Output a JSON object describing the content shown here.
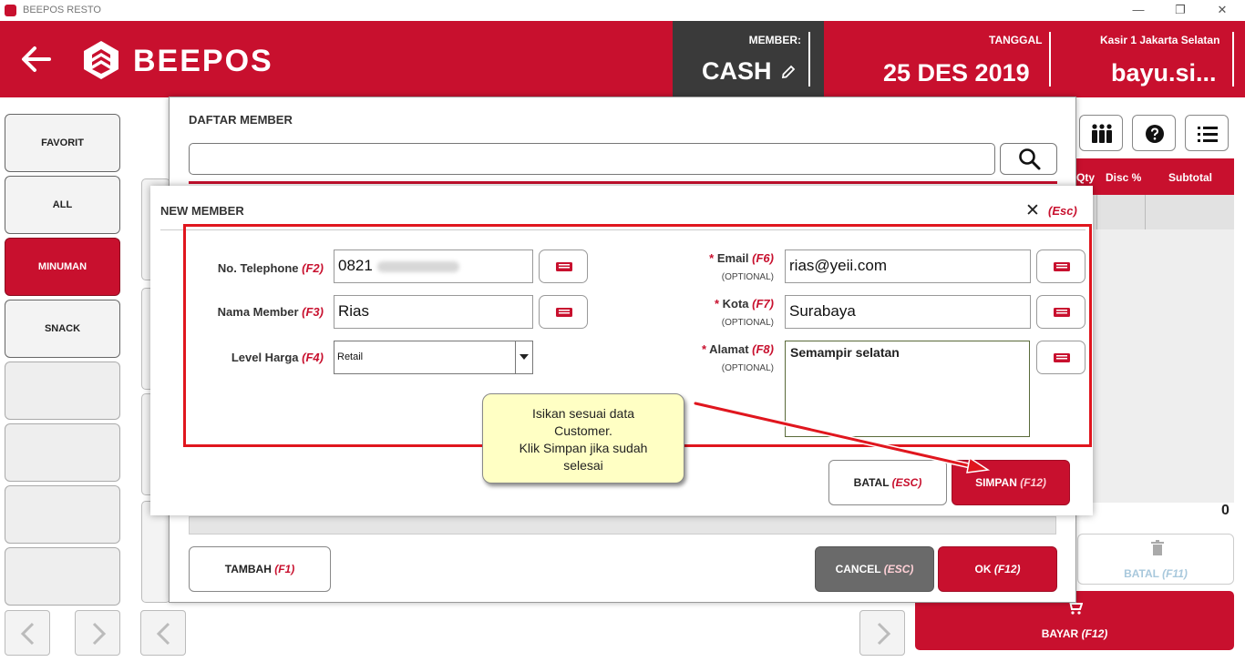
{
  "window": {
    "title": "BEEPOS RESTO",
    "controls": {
      "minimize": "—",
      "restore": "❐",
      "close": "✕"
    }
  },
  "header": {
    "brand": "BEEPOS",
    "member_label": "MEMBER:",
    "member_value": "CASH",
    "date_label": "TANGGAL",
    "date_value": "25 DES 2019",
    "cashier_label": "Kasir 1 Jakarta Selatan",
    "cashier_value": "bayu.si..."
  },
  "categories": [
    "FAVORIT",
    "ALL",
    "MINUMAN",
    "SNACK"
  ],
  "order_table": {
    "columns": [
      "Qty",
      "Disc %",
      "Subtotal"
    ],
    "total": "0"
  },
  "actions": {
    "batal_label": "BATAL",
    "batal_key": "(F11)",
    "bayar_label": "BAYAR",
    "bayar_key": "(F12)"
  },
  "daftar_member": {
    "title": "DAFTAR MEMBER",
    "search_value": "",
    "tambah_label": "TAMBAH",
    "tambah_key": "(F1)",
    "cancel_label": "CANCEL",
    "cancel_key": "(ESC)",
    "ok_label": "OK",
    "ok_key": "(F12)"
  },
  "new_member": {
    "title": "NEW MEMBER",
    "close_key": "(Esc)",
    "telephone": {
      "label": "No. Telephone",
      "key": "(F2)",
      "value": "0821"
    },
    "nama": {
      "label": "Nama Member",
      "key": "(F3)",
      "value": "Rias"
    },
    "level": {
      "label": "Level Harga",
      "key": "(F4)",
      "value": "Retail"
    },
    "email": {
      "label": "Email",
      "key": "(F6)",
      "optional": "(OPTIONAL)",
      "value": "rias@yeii.com"
    },
    "kota": {
      "label": "Kota",
      "key": "(F7)",
      "optional": "(OPTIONAL)",
      "value": "Surabaya"
    },
    "alamat": {
      "label": "Alamat",
      "key": "(F8)",
      "optional": "(OPTIONAL)",
      "value": "Semampir selatan"
    },
    "required_mark": "*",
    "batal_label": "BATAL",
    "batal_key": "(ESC)",
    "simpan_label": "SIMPAN",
    "simpan_key": "(F12)"
  },
  "callout": {
    "line1": "Isikan sesuai data",
    "line2": "Customer.",
    "line3": "Klik Simpan jika sudah",
    "line4": "selesai"
  },
  "colors": {
    "brand_red": "#c8102e",
    "dark_panel": "#3a3a3a",
    "highlight": "#e0161e",
    "callout_bg": "#ffffc4"
  }
}
